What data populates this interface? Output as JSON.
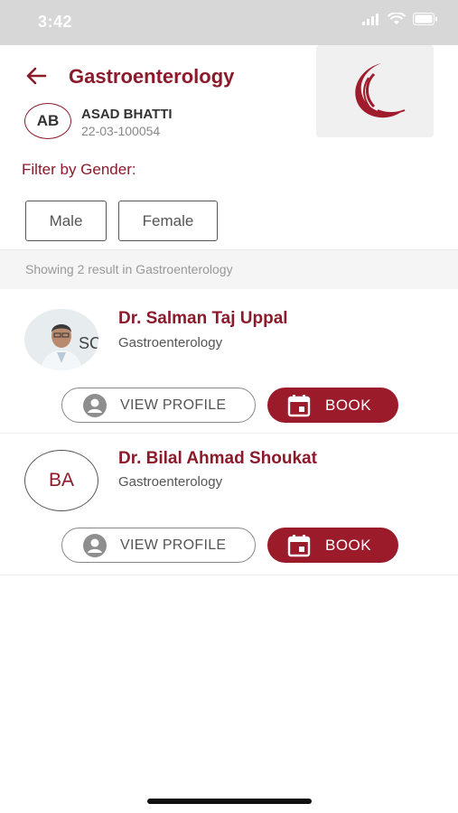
{
  "status": {
    "time": "3:42"
  },
  "header": {
    "title": "Gastroenterology"
  },
  "user": {
    "initials": "AB",
    "name": "ASAD BHATTI",
    "id": "22-03-100054"
  },
  "filter": {
    "label": "Filter by Gender:",
    "options": [
      "Male",
      "Female"
    ]
  },
  "results": {
    "summary": "Showing 2 result in Gastroenterology"
  },
  "doctors": [
    {
      "name": "Dr. Salman Taj Uppal",
      "specialty": "Gastroenterology",
      "profile_label": "VIEW PROFILE",
      "book_label": "BOOK"
    },
    {
      "initials": "BA",
      "name": "Dr. Bilal Ahmad Shoukat",
      "specialty": "Gastroenterology",
      "profile_label": "VIEW PROFILE",
      "book_label": "BOOK"
    }
  ],
  "colors": {
    "brand": "#8b1a2b",
    "book_button": "#9b1b2a",
    "status_bar": "#d7d7d7"
  },
  "icons": {
    "back": "arrow-left-icon",
    "profile": "person-circle-icon",
    "book": "calendar-icon"
  }
}
